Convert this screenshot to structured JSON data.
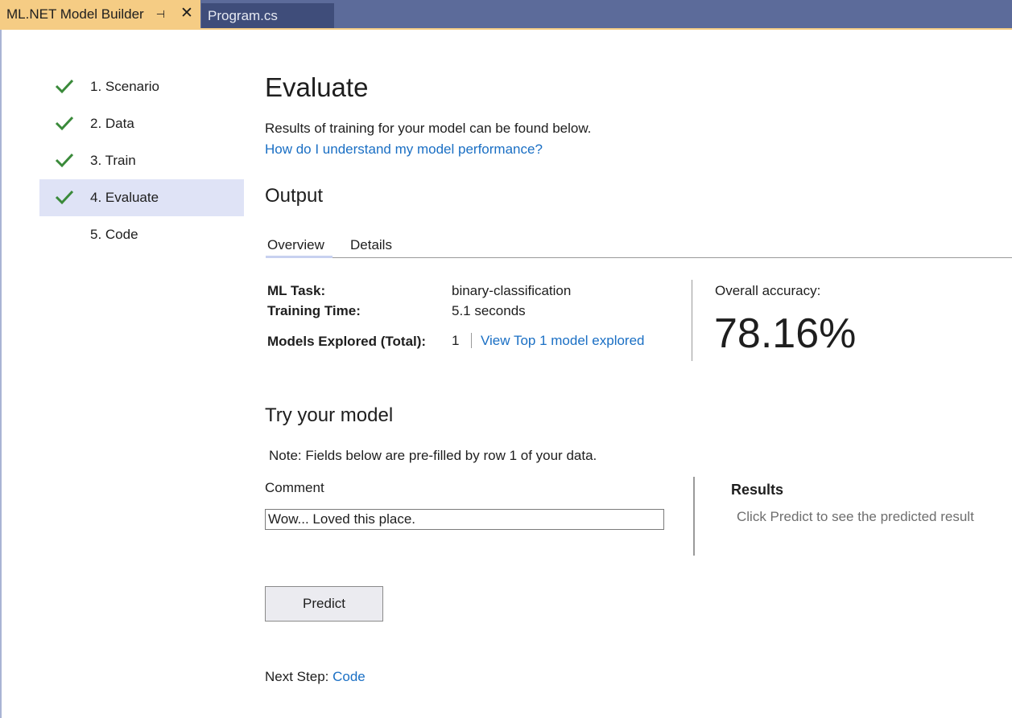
{
  "tabs": {
    "active": {
      "title": "ML.NET Model Builder",
      "pin_glyph": "⊣",
      "close_glyph": "✕"
    },
    "other": {
      "title": "Program.cs"
    }
  },
  "steps": [
    {
      "label": "1. Scenario",
      "completed": true,
      "active": false
    },
    {
      "label": "2. Data",
      "completed": true,
      "active": false
    },
    {
      "label": "3. Train",
      "completed": true,
      "active": false
    },
    {
      "label": "4. Evaluate",
      "completed": true,
      "active": true
    },
    {
      "label": "5. Code",
      "completed": false,
      "active": false
    }
  ],
  "page": {
    "title": "Evaluate",
    "intro": "Results of training for your model can be found below.",
    "help_link": "How do I understand my model performance?"
  },
  "output": {
    "heading": "Output",
    "tabs": {
      "overview": "Overview",
      "details": "Details"
    },
    "metrics": {
      "ml_task_label": "ML Task:",
      "ml_task_value": "binary-classification",
      "training_time_label": "Training Time:",
      "training_time_value": "5.1 seconds",
      "models_explored_label": "Models Explored (Total):",
      "models_explored_value": "1",
      "view_models_link": "View Top 1 model explored"
    },
    "accuracy": {
      "label": "Overall accuracy:",
      "value": "78.16%"
    }
  },
  "try_model": {
    "heading": "Try your model",
    "note": "Note: Fields below are pre-filled by row 1 of your data.",
    "field_label": "Comment",
    "field_value": "Wow... Loved this place.",
    "results_heading": "Results",
    "results_message": "Click Predict to see the predicted result",
    "predict_label": "Predict"
  },
  "next_step": {
    "label": "Next Step:",
    "link": "Code"
  },
  "colors": {
    "tab_active": "#f5cc84",
    "tabstrip": "#5c6b9a",
    "tab_inactive": "#3f4d7a",
    "step_active_bg": "#dfe3f6",
    "check_green": "#3a8a3a",
    "link": "#1a6fc4"
  },
  "icons": {
    "step_check": "checkmark-icon",
    "tab_pin": "pin-icon",
    "tab_close": "close-icon"
  }
}
